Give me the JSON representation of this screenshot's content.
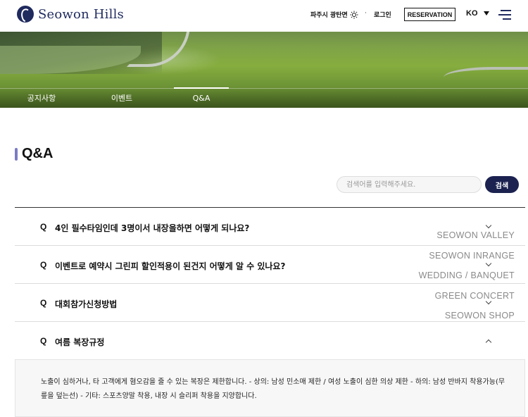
{
  "header": {
    "logo_text": "Seowon Hills",
    "weather": "파주시 광탄면",
    "weather_icon": "sun-icon",
    "separator": "·",
    "login": "로그인",
    "reservation": "RESERVATION",
    "language": "KO",
    "menu_icon": "hamburger-menu-icon"
  },
  "tabs": [
    {
      "label": "공지사항",
      "active": false
    },
    {
      "label": "이벤트",
      "active": false
    },
    {
      "label": "Q&A",
      "active": true
    }
  ],
  "page_title": "Q&A",
  "search": {
    "placeholder": "검색어를 입력해주세요.",
    "button": "검색"
  },
  "faq": {
    "q_marker": "Q",
    "items": [
      {
        "question": "4인 필수타임인데 3명이서 내장을하면 어떻게 되나요?",
        "expanded": false
      },
      {
        "question": "이벤트로 예약시 그린피 할인적용이 된건지 어떻게 알 수 있나요?",
        "expanded": false
      },
      {
        "question": "대회참가신청방법",
        "expanded": false
      },
      {
        "question": "여름 복장규정",
        "expanded": true
      }
    ],
    "answer": "노출이 심하거나, 타 고객에게 혐오감을 줄 수 있는 복장은 제한합니다. - 상의: 남성 민소매 제한 / 여성 노출이 심한 의상 제한 - 하의: 남성 반바지 착용가능(무릎을 덮는선) - 기타: 스포츠양말 착용, 내장 시 슬리퍼 착용을 지양합니다."
  },
  "site_links": [
    "SEOWON VALLEY",
    "SEOWON INRANGE",
    "WEDDING / BANQUET",
    "GREEN CONCERT",
    "SEOWON SHOP"
  ],
  "colors": {
    "brand_navy": "#1f2a5e",
    "button_navy": "#1b2250",
    "title_accent": "#7b7cc4"
  }
}
